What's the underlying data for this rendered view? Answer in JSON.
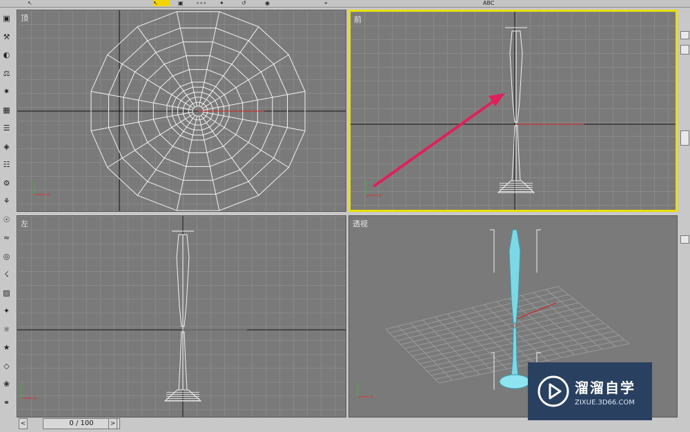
{
  "toolbar": {
    "items": [
      "↖",
      "▣",
      "∘∘∘",
      "✦",
      "⌖",
      "↺",
      "◉",
      "ABC"
    ],
    "active_color": "#f2d400"
  },
  "viewports": {
    "top": {
      "label": "顶"
    },
    "front": {
      "label": "前"
    },
    "left": {
      "label": "左"
    },
    "persp": {
      "label": "透视"
    }
  },
  "axes": {
    "x": "x",
    "y": "y",
    "z": "z"
  },
  "time_slider": {
    "value": "0 / 100",
    "prev": "<",
    "next": ">"
  },
  "watermark": {
    "name": "溜溜自学",
    "url": "ZIXUE.3D66.COM"
  },
  "left_tools": [
    "hammer-icon",
    "create-icon",
    "modify-icon",
    "hierarchy-icon",
    "motion-icon",
    "display-icon",
    "utilities-icon",
    "geometry-icon",
    "shapes-icon",
    "lights-icon",
    "cameras-icon",
    "helpers-icon",
    "spacewarps-icon",
    "systems-icon",
    "wave-icon",
    "teapot-icon",
    "select-icon",
    "move-icon",
    "rotate-icon",
    "scale-icon",
    "link-icon",
    "bind-icon"
  ]
}
